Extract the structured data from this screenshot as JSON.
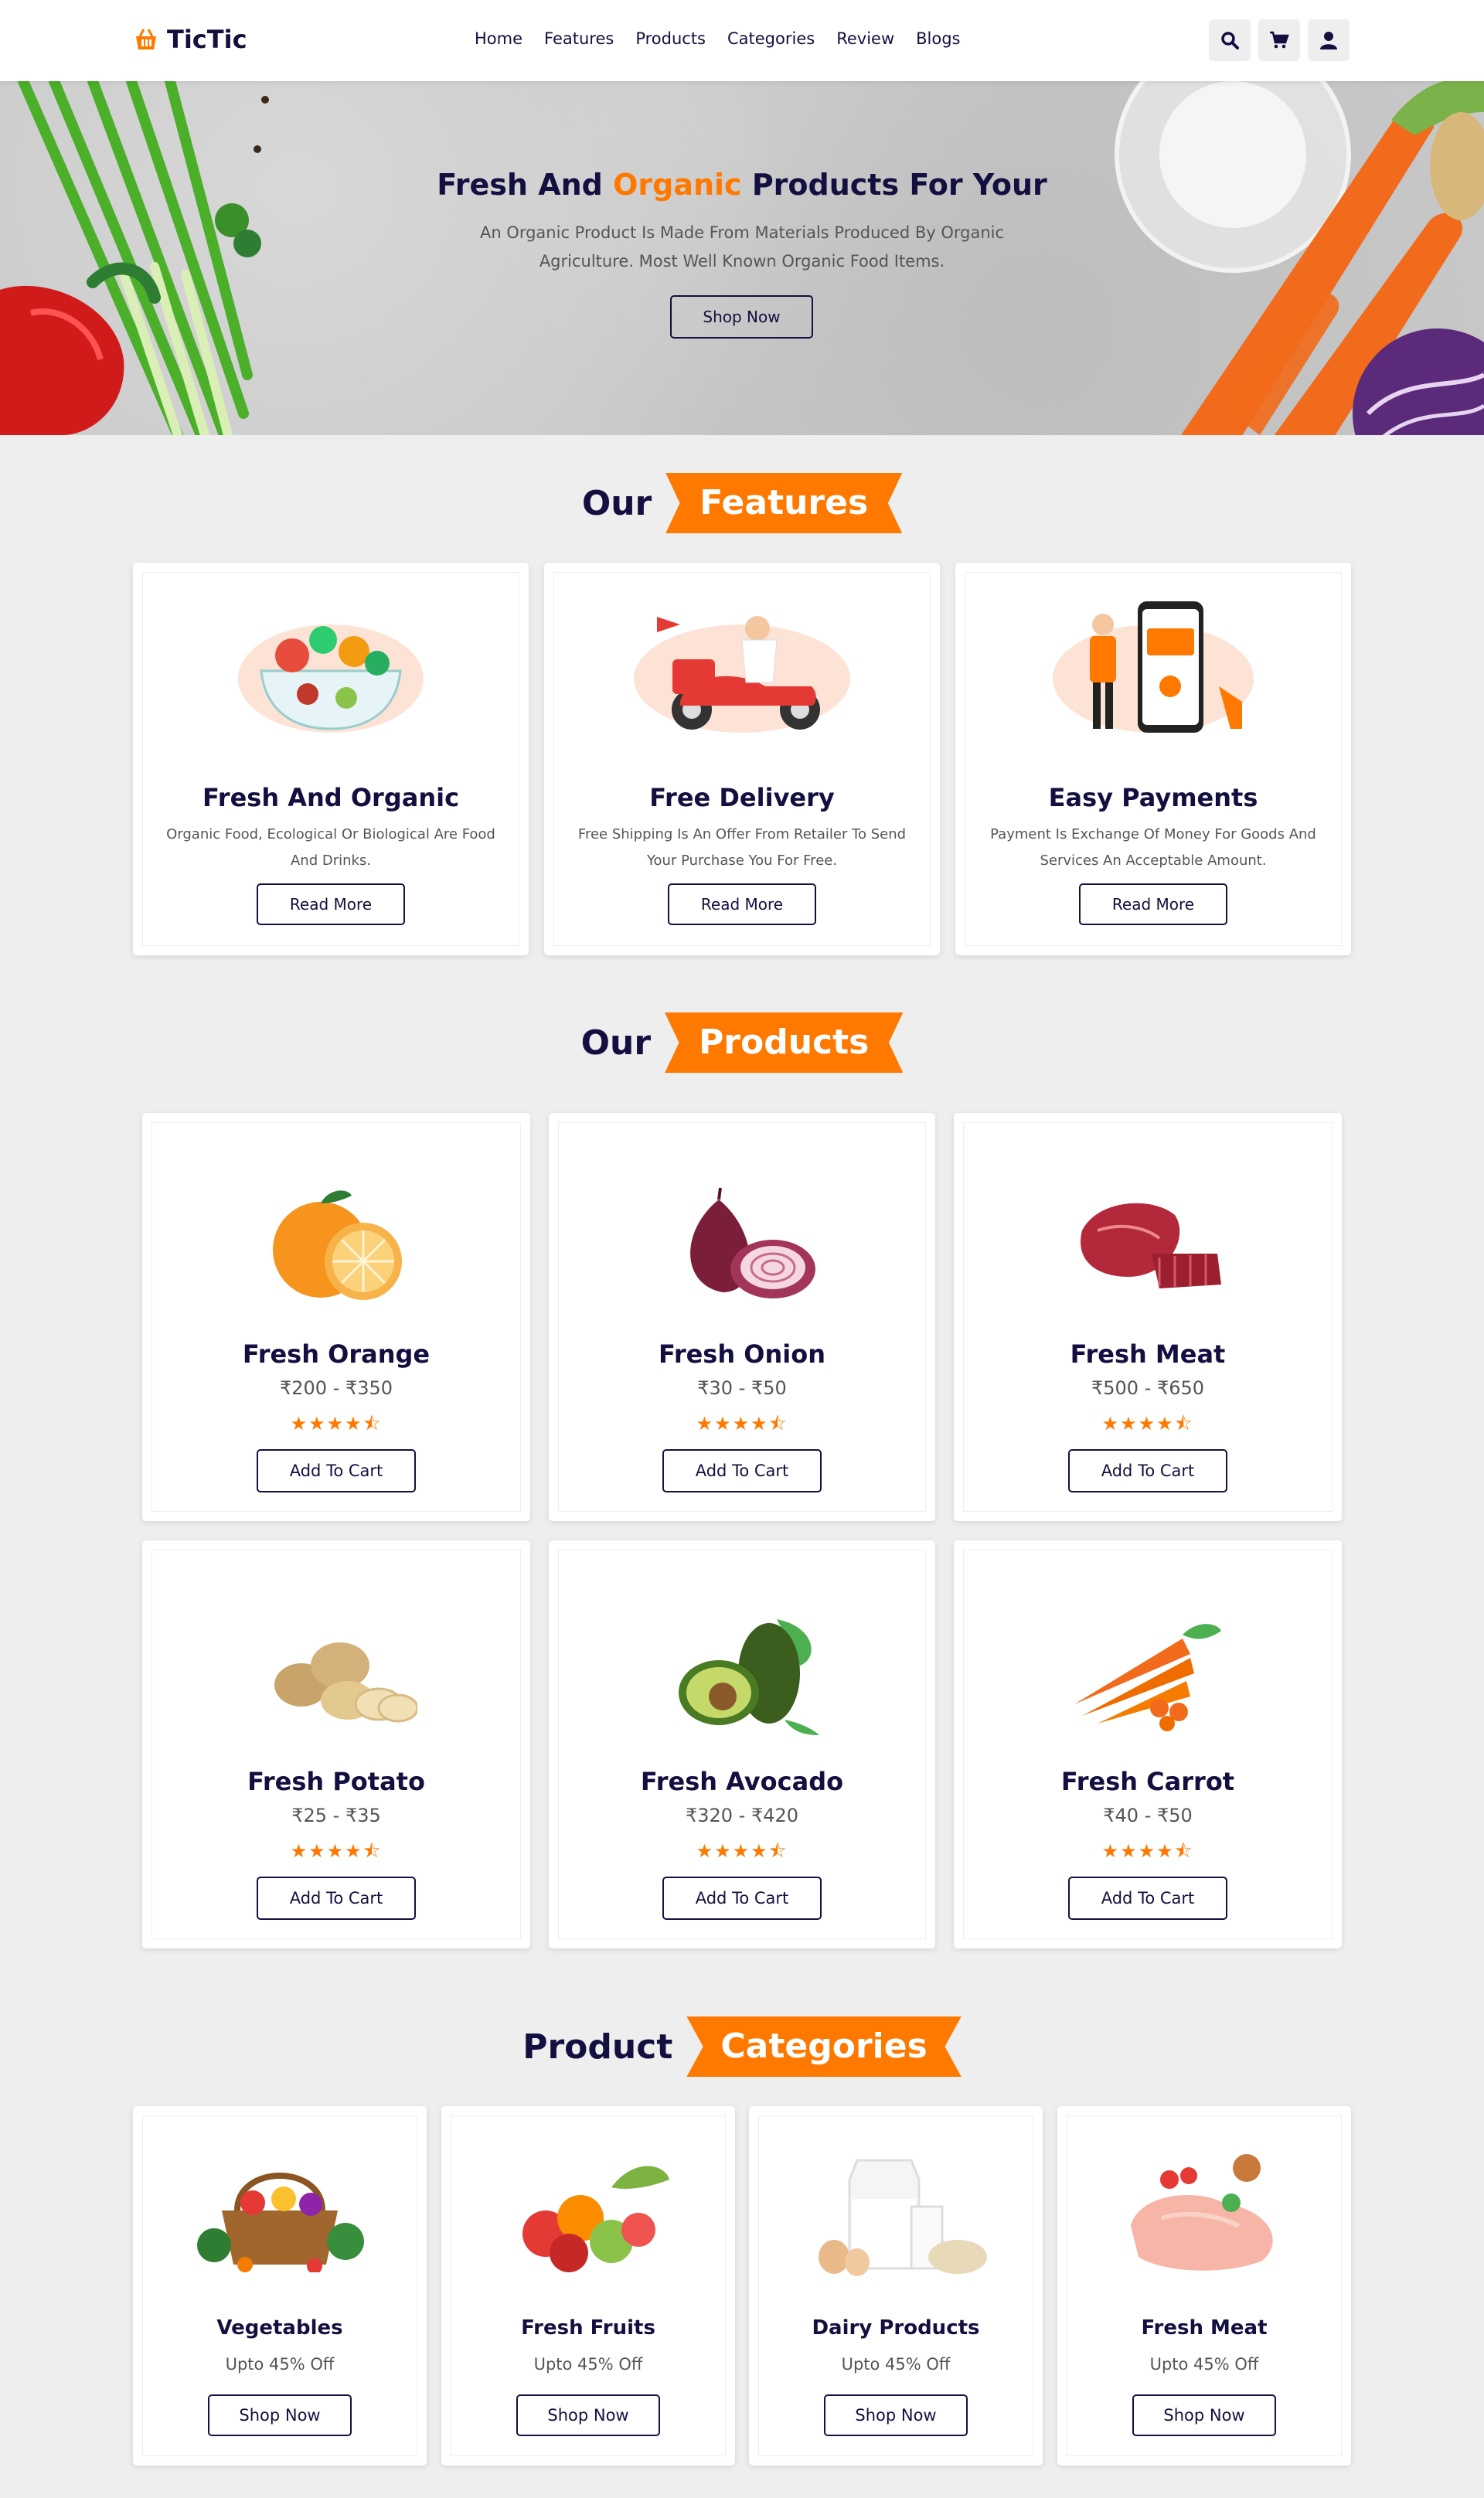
{
  "header": {
    "logo": "TicTic",
    "nav": [
      "Home",
      "Features",
      "Products",
      "Categories",
      "Review",
      "Blogs"
    ],
    "icons": [
      "search-icon",
      "cart-icon",
      "user-icon"
    ]
  },
  "hero": {
    "title_pre": "Fresh And ",
    "title_accent": "Organic",
    "title_post": " Products For Your",
    "text": "An Organic Product Is Made From Materials Produced By Organic Agriculture. Most Well Known Organic Food Items.",
    "button": "Shop Now"
  },
  "features": {
    "heading_plain": "Our",
    "heading_accent": "Features",
    "items": [
      {
        "title": "Fresh And Organic",
        "desc": "Organic Food, Ecological Or Biological Are Food And Drinks.",
        "button": "Read More"
      },
      {
        "title": "Free Delivery",
        "desc": "Free Shipping Is An Offer From Retailer To Send Your Purchase You For Free.",
        "button": "Read More"
      },
      {
        "title": "Easy Payments",
        "desc": "Payment Is Exchange Of Money For Goods And Services An Acceptable Amount.",
        "button": "Read More"
      }
    ]
  },
  "products": {
    "heading_plain": "Our",
    "heading_accent": "Products",
    "items": [
      {
        "name": "Fresh Orange",
        "price": "₹200 - ₹350",
        "rating": 4.5,
        "button": "Add To Cart"
      },
      {
        "name": "Fresh Onion",
        "price": "₹30 - ₹50",
        "rating": 4.5,
        "button": "Add To Cart"
      },
      {
        "name": "Fresh Meat",
        "price": "₹500 - ₹650",
        "rating": 4.5,
        "button": "Add To Cart"
      },
      {
        "name": "Fresh Potato",
        "price": "₹25 - ₹35",
        "rating": 4.5,
        "button": "Add To Cart"
      },
      {
        "name": "Fresh Avocado",
        "price": "₹320 - ₹420",
        "rating": 4.5,
        "button": "Add To Cart"
      },
      {
        "name": "Fresh Carrot",
        "price": "₹40 - ₹50",
        "rating": 4.5,
        "button": "Add To Cart"
      }
    ]
  },
  "categories": {
    "heading_plain": "Product",
    "heading_accent": "Categories",
    "items": [
      {
        "name": "Vegetables",
        "offer": "Upto 45% Off",
        "button": "Shop Now"
      },
      {
        "name": "Fresh Fruits",
        "offer": "Upto 45% Off",
        "button": "Shop Now"
      },
      {
        "name": "Dairy Products",
        "offer": "Upto 45% Off",
        "button": "Shop Now"
      },
      {
        "name": "Fresh Meat",
        "offer": "Upto 45% Off",
        "button": "Shop Now"
      }
    ]
  },
  "colors": {
    "accent": "#ff7800",
    "primary": "#130f40",
    "background": "#eeeeee"
  }
}
